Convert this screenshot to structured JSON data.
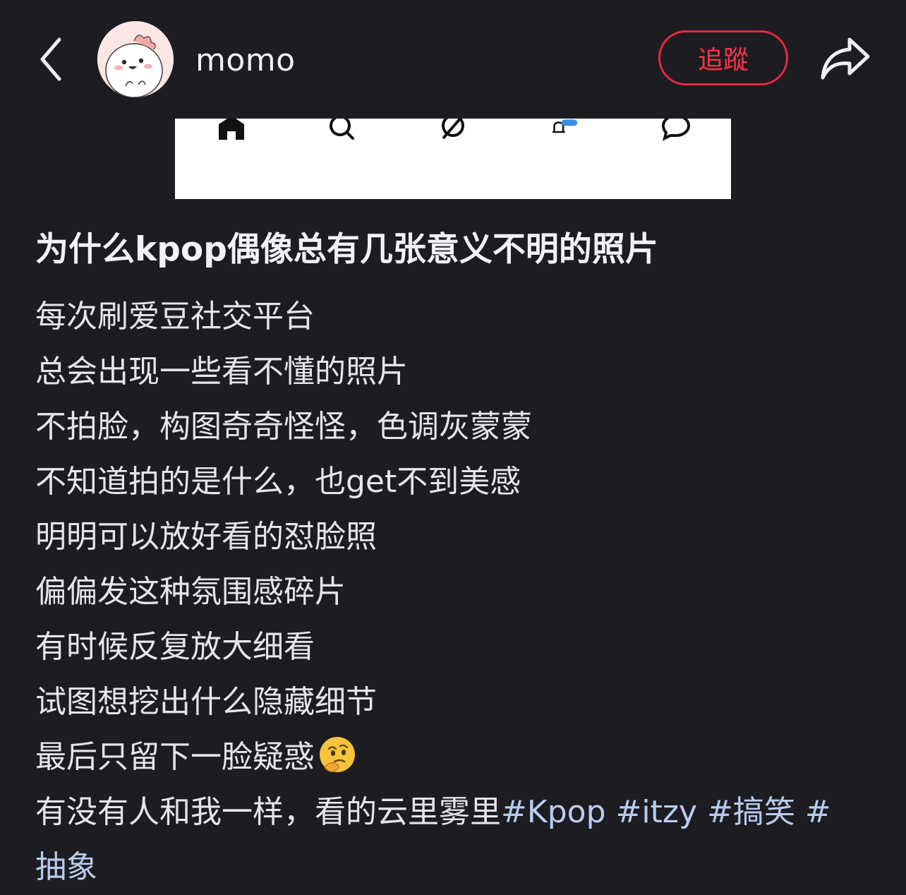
{
  "header": {
    "username": "momo",
    "follow_label": "追蹤",
    "icons": {
      "back": "chevron-left-icon",
      "share": "share-arrow-icon",
      "avatar": "cartoon-avatar"
    }
  },
  "image_strip": {
    "icons": [
      "home-icon",
      "search-icon",
      "compass-icon",
      "bell-icon",
      "chat-icon"
    ]
  },
  "post": {
    "title": "为什么kpop偶像总有几张意义不明的照片",
    "lines": [
      "每次刷爱豆社交平台",
      "总会出现一些看不懂的照片",
      "不拍脸，构图奇奇怪怪，色调灰蒙蒙",
      "不知道拍的是什么，也get不到美感",
      "明明可以放好看的怼脸照",
      "偏偏发这种氛围感碎片",
      "有时候反复放大细看",
      "试图想挖出什么隐藏细节",
      "最后只留下一脸疑惑"
    ],
    "emoji": "thinking-face-emoji",
    "last_line_text": "有没有人和我一样，看的云里雾里",
    "tags": [
      "#Kpop",
      "#itzy",
      "#搞笑",
      "#",
      "抽象"
    ]
  },
  "colors": {
    "background": "#1c1c21",
    "follow_red": "#e8283f",
    "tag_blue": "#b9cdf0",
    "text": "#e6e6e8"
  }
}
